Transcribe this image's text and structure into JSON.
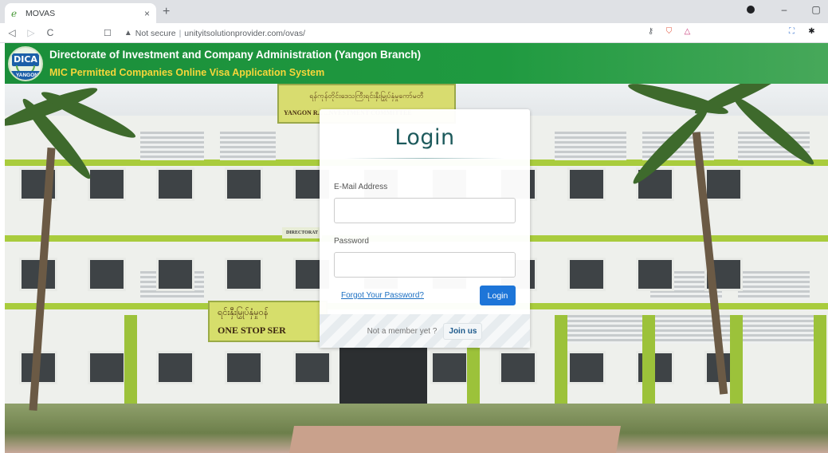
{
  "browser": {
    "tab_title": "MOVAS",
    "tab_close": "×",
    "new_tab": "+",
    "not_secure": "Not secure",
    "url": "unityitsolutionprovider.com/ovas/",
    "nav": {
      "back": "◁",
      "forward": "▷",
      "reload": "C",
      "bookmark": "☐"
    },
    "window": {
      "minimize": "–",
      "maximize": "▢"
    }
  },
  "header": {
    "logo_mark": "DICA",
    "logo_city": "YANGON",
    "title": "Directorate of Investment and Company Administration (Yangon Branch)",
    "subtitle": "MIC Permitted Companies Online Visa Application System"
  },
  "photo_signs": {
    "top_sign_line1": "ရန်ကုန်တိုင်းဒေသကြီးရင်းနှီးမြှုပ်နှံမှုကော်မတီ",
    "top_sign_line2": "YANGON R... ...NVESTMENT COMMITTEE",
    "one_stop_line1": "ရင်းနှီးမြှုပ်နှံမှုဝန်",
    "one_stop_line2": "ONE STOP SER",
    "small_sign": "DIRECTORAT"
  },
  "login": {
    "title": "Login",
    "email_label": "E-Mail Address",
    "email_value": "",
    "password_label": "Password",
    "password_value": "",
    "forgot_link": "Forgot Your Password?",
    "login_button": "Login",
    "not_member": "Not a member yet ?",
    "join_button": "Join us"
  },
  "colors": {
    "header_green": "#1b8e3a",
    "subtitle_yellow": "#f7d63a",
    "title_teal": "#1d5a5c",
    "button_blue": "#1d75d8",
    "link_blue": "#1b6fc2"
  },
  "icons": [
    "favicon-icon",
    "close-icon",
    "plus-icon",
    "back-icon",
    "forward-icon",
    "reload-icon",
    "bookmark-icon",
    "warning-icon",
    "key-icon",
    "brave-shield-icon",
    "triangle-icon",
    "translate-icon",
    "puzzle-icon",
    "profile-icon"
  ]
}
